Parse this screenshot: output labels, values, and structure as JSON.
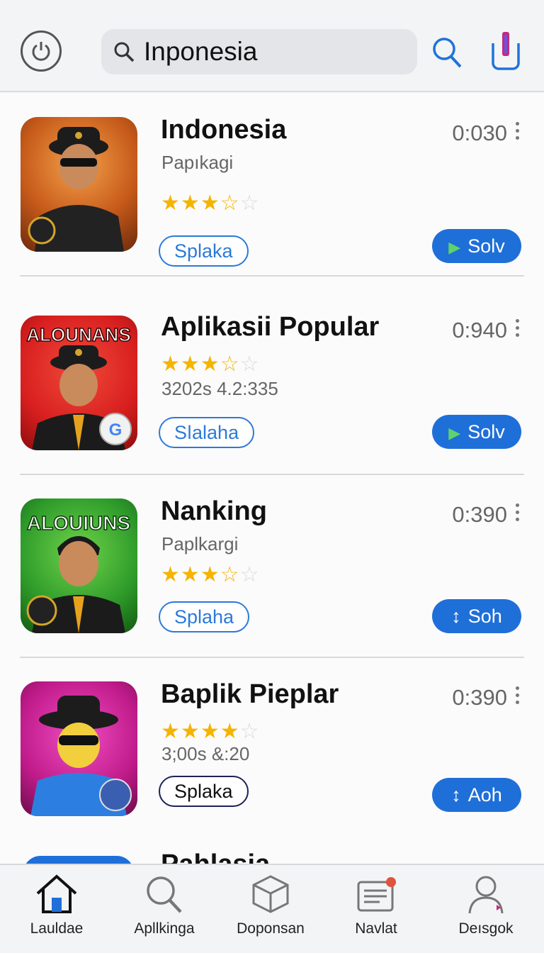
{
  "header": {
    "search_value": "Inponesia",
    "icons": [
      "power-icon",
      "search-icon",
      "bookmark-icon"
    ]
  },
  "apps": [
    {
      "name": "Indonesia",
      "subtitle": "Papıkagi",
      "rating": 3,
      "tag": "Splaka",
      "time": "0:030",
      "action": "Solv",
      "action_icon": "play-icon",
      "thumb_bg": "#c65a1a",
      "thumb_text": ""
    },
    {
      "name": "Aplikasii Popular",
      "subtitle": "3202s 4.2:335",
      "rating": 3,
      "tag": "Sǀalaha",
      "time": "0:940",
      "action": "Solv",
      "action_icon": "play-icon",
      "thumb_bg": "#d81f1f",
      "thumb_text": "ALOUNANS"
    },
    {
      "name": "Nanking",
      "subtitle": "Paplkargi",
      "rating": 3,
      "tag": "Splaha",
      "time": "0:390",
      "action": "Soh",
      "action_icon": "sort-icon",
      "thumb_bg": "#2e9b2a",
      "thumb_text": "ALOUIUNS"
    },
    {
      "name": "Baplik Pieplar",
      "subtitle": "3;00s &:20",
      "rating": 4,
      "tag": "Splaka",
      "time": "0:390",
      "action": "Aoh",
      "action_icon": "sort-icon",
      "thumb_bg": "#c01b8a",
      "thumb_text": ""
    }
  ],
  "partial_item": {
    "name": "Pahlasia"
  },
  "colors": {
    "accent": "#1f6fd9",
    "star": "#f5b400"
  },
  "nav": [
    {
      "label": "Lauldae",
      "icon": "home-icon"
    },
    {
      "label": "Apllkinga",
      "icon": "search-icon"
    },
    {
      "label": "Doponsan",
      "icon": "box-icon"
    },
    {
      "label": "Navlat",
      "icon": "news-icon"
    },
    {
      "label": "Deısgok",
      "icon": "profile-icon"
    }
  ]
}
